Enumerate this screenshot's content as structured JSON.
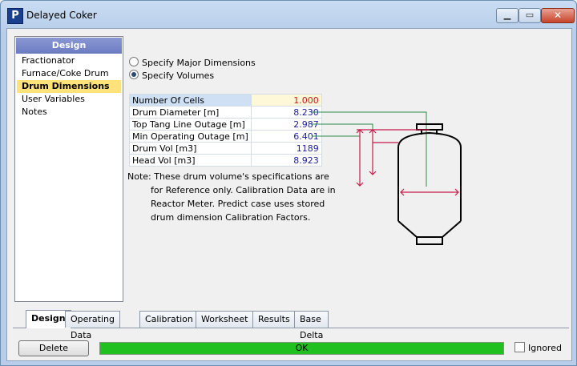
{
  "window": {
    "title": "Delayed Coker",
    "icon_letter": "P",
    "minimize_icon": "minimize-icon",
    "maximize_icon": "maximize-icon",
    "close_icon": "close-icon",
    "minimize_glyph": "▁",
    "maximize_glyph": "▭",
    "close_glyph": "✕"
  },
  "nav": {
    "header": "Design",
    "items": [
      {
        "label": "Fractionator",
        "selected": false
      },
      {
        "label": "Furnace/Coke Drum",
        "selected": false
      },
      {
        "label": "Drum Dimensions",
        "selected": true
      },
      {
        "label": "User Variables",
        "selected": false
      },
      {
        "label": "Notes",
        "selected": false
      }
    ]
  },
  "options": {
    "major": {
      "label": "Specify Major Dimensions",
      "checked": false
    },
    "volumes": {
      "label": "Specify Volumes",
      "checked": true
    }
  },
  "grid": {
    "rows": [
      {
        "label": "Number Of Cells",
        "value": "1.000"
      },
      {
        "label": "Drum Diameter [m]",
        "value": "8.230"
      },
      {
        "label": "Top Tang Line Outage [m]",
        "value": "2.987"
      },
      {
        "label": "Min Operating Outage [m]",
        "value": "6.401"
      },
      {
        "label": "Drum Vol [m3]",
        "value": "1189"
      },
      {
        "label": "Head Vol [m3]",
        "value": "8.923"
      }
    ]
  },
  "note": {
    "line1": "Note: These drum volume's specifications are",
    "line2": "for Reference only. Calibration Data are in",
    "line3": "Reactor Meter. Predict case uses stored",
    "line4": "drum dimension Calibration Factors."
  },
  "tabs": [
    {
      "label": "Design",
      "active": true
    },
    {
      "label": "Operating Data",
      "active": false
    },
    {
      "label": "Calibration",
      "active": false
    },
    {
      "label": "Worksheet",
      "active": false
    },
    {
      "label": "Results",
      "active": false
    },
    {
      "label": "Base Delta",
      "active": false
    }
  ],
  "footer": {
    "delete_label": "Delete",
    "status_text": "OK",
    "ignored_label": "Ignored",
    "ignored_checked": false
  },
  "colors": {
    "status_ok": "#20c020",
    "nav_selected": "#ffe27a",
    "nav_header": "#7a88c8",
    "dimension_red": "#c41a4a",
    "leader_green": "#2a8a4a",
    "value_blue": "#1a1aa0"
  }
}
